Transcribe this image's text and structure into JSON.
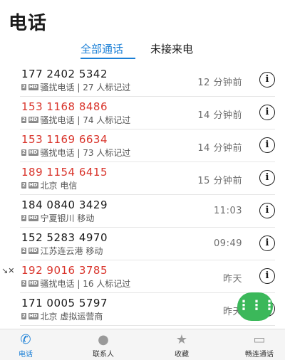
{
  "header": {
    "title": "电话"
  },
  "tabs": [
    {
      "label": "全部通话"
    },
    {
      "label": "未接来电"
    }
  ],
  "calls": [
    {
      "number": "177 2402 5342",
      "sim": "2",
      "hd": "HD",
      "detail": "骚扰电话 | 27 人标记过",
      "time": "12 分钟前",
      "missed": false
    },
    {
      "number": "153 1168 8486",
      "sim": "2",
      "hd": "HD",
      "detail": "骚扰电话 | 74 人标记过",
      "time": "14 分钟前",
      "missed": true
    },
    {
      "number": "153 1169 6634",
      "sim": "2",
      "hd": "HD",
      "detail": "骚扰电话 | 73 人标记过",
      "time": "14 分钟前",
      "missed": true
    },
    {
      "number": "189 1154 6415",
      "sim": "2",
      "hd": "HD",
      "detail": "北京 电信",
      "time": "15 分钟前",
      "missed": true
    },
    {
      "number": "184 0840 3429",
      "sim": "2",
      "hd": "HD",
      "detail": "宁夏银川 移动",
      "time": "11:03",
      "missed": false
    },
    {
      "number": "152 5283 4970",
      "sim": "2",
      "hd": "HD",
      "detail": "江苏连云港 移动",
      "time": "09:49",
      "missed": false
    },
    {
      "number": "192 9016 3785",
      "sim": "2",
      "hd": "HD",
      "detail": "骚扰电话 | 16 人标记过",
      "time": "昨天",
      "missed": true
    },
    {
      "number": "171 0005 5797",
      "sim": "2",
      "hd": "HD",
      "detail": "北京 虚拟运营商",
      "time": "昨天",
      "missed": false
    }
  ],
  "info_glyph": "i",
  "dialpad_glyph": "⋮⋮⋮",
  "bottom_nav": [
    {
      "label": "电话",
      "icon": "phone-icon",
      "glyph": "✆"
    },
    {
      "label": "联系人",
      "icon": "person-icon",
      "glyph": "●"
    },
    {
      "label": "收藏",
      "icon": "star-icon",
      "glyph": "★"
    },
    {
      "label": "畅连通话",
      "icon": "video-call-icon",
      "glyph": "▭"
    }
  ],
  "colors": {
    "accent": "#1a7fd6",
    "missed": "#d9342b",
    "fab": "#3bb85a"
  }
}
